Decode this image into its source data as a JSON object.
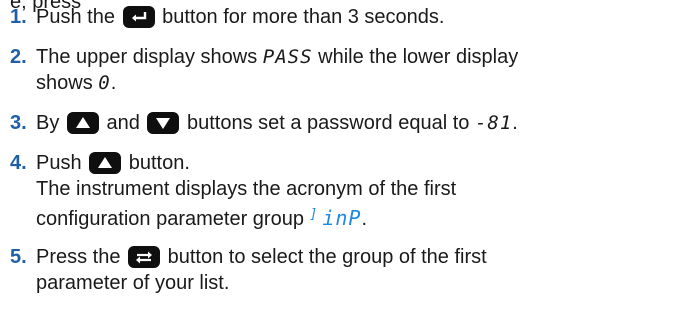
{
  "top_fragment": "e, press",
  "steps": [
    {
      "num": "1.",
      "before": "Push the",
      "after": "button for more than 3 seconds."
    },
    {
      "num": "2.",
      "before": "The upper display shows",
      "seg_upper": "PASS",
      "middle": "while the lower display",
      "line2_before": "shows",
      "seg_lower": "0",
      "line2_after": "."
    },
    {
      "num": "3.",
      "before": "By",
      "middle": "and",
      "after": "buttons set a password equal to",
      "seg_password": "-81",
      "end": "."
    },
    {
      "num": "4.",
      "before": "Push",
      "after": "button.",
      "line2": "The instrument displays the acronym of the first",
      "line3_before": "configuration parameter group",
      "seg_group_sup": "]",
      "seg_group": "inP",
      "line3_after": "."
    },
    {
      "num": "5.",
      "before": "Press the",
      "after": "button to select the group of the first",
      "line2": "parameter of your list."
    }
  ],
  "icons": [
    "enter-key-icon",
    "up-arrow-key-icon",
    "down-arrow-key-icon",
    "cycle-key-icon"
  ]
}
